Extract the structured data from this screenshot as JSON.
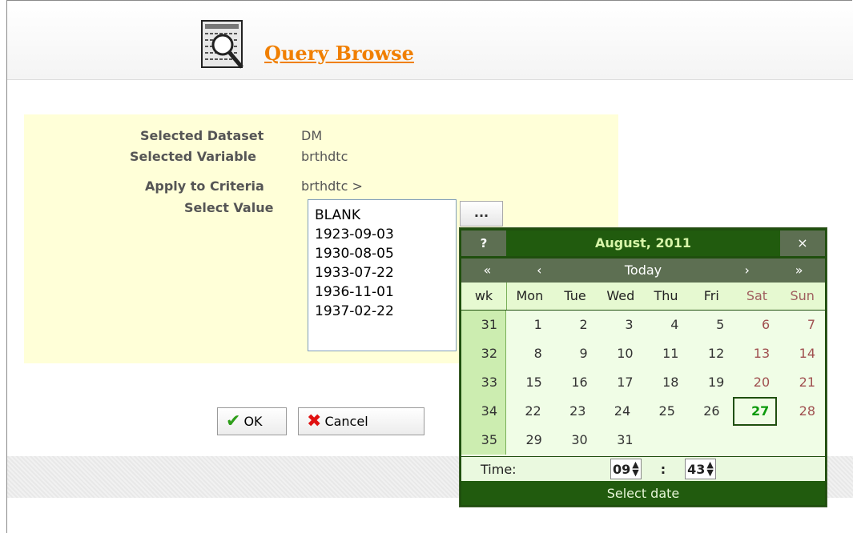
{
  "header": {
    "title": "Query Browse",
    "icon": "query-browse-icon"
  },
  "form": {
    "selected_dataset_label": "Selected Dataset",
    "selected_dataset_value": "DM",
    "selected_variable_label": "Selected Variable",
    "selected_variable_value": "brthdtc",
    "apply_criteria_label": "Apply to Criteria",
    "apply_criteria_value": "brthdtc >",
    "select_value_label": "Select Value",
    "values": [
      "BLANK",
      "1923-09-03",
      "1930-08-05",
      "1933-07-22",
      "1936-11-01",
      "1937-02-22"
    ],
    "picker_button": "...",
    "ok_label": "OK",
    "cancel_label": "Cancel"
  },
  "calendar": {
    "help": "?",
    "title": "August, 2011",
    "close": "×",
    "nav_prev_year": "«",
    "nav_prev_month": "‹",
    "today": "Today",
    "nav_next_month": "›",
    "nav_next_year": "»",
    "wk_label": "wk",
    "day_names": [
      "Mon",
      "Tue",
      "Wed",
      "Thu",
      "Fri",
      "Sat",
      "Sun"
    ],
    "weeks": [
      {
        "wk": "31",
        "days": [
          "1",
          "2",
          "3",
          "4",
          "5",
          "6",
          "7"
        ]
      },
      {
        "wk": "32",
        "days": [
          "8",
          "9",
          "10",
          "11",
          "12",
          "13",
          "14"
        ]
      },
      {
        "wk": "33",
        "days": [
          "15",
          "16",
          "17",
          "18",
          "19",
          "20",
          "21"
        ]
      },
      {
        "wk": "34",
        "days": [
          "22",
          "23",
          "24",
          "25",
          "26",
          "27",
          "28"
        ]
      },
      {
        "wk": "35",
        "days": [
          "29",
          "30",
          "31",
          "",
          "",
          "",
          ""
        ]
      }
    ],
    "selected_day": "27",
    "time_label": "Time:",
    "hour": "09",
    "time_sep": ":",
    "minute": "43",
    "status": "Select date",
    "accent": "#215b0e"
  }
}
